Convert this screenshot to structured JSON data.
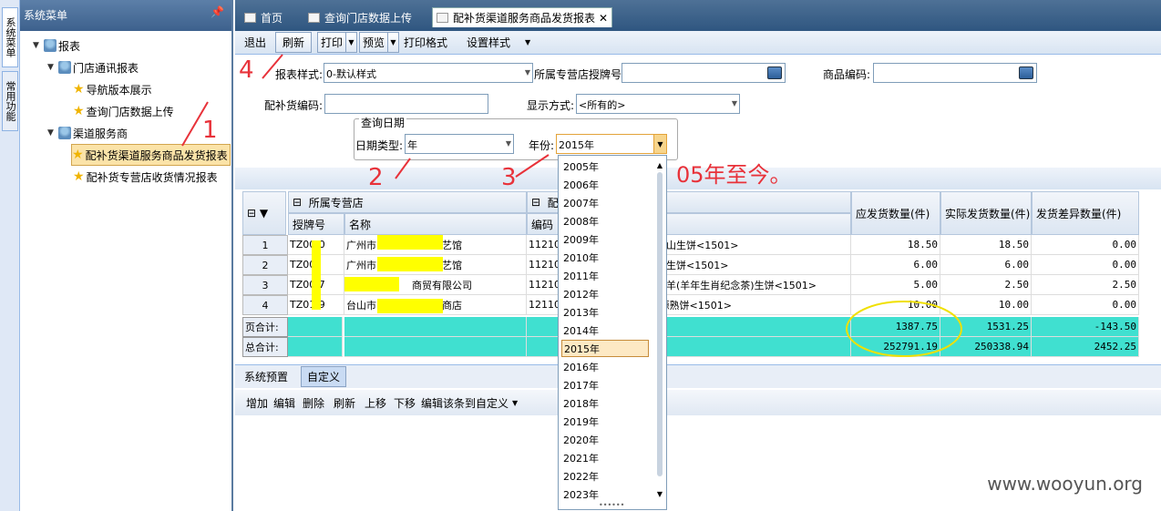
{
  "side_tabs": [
    "系统菜单",
    "常用功能"
  ],
  "sidebar": {
    "title": "系统菜单",
    "tree": [
      {
        "label": "报表",
        "level": 0
      },
      {
        "label": "门店通讯报表",
        "level": 1
      },
      {
        "label": "导航版本展示",
        "level": 2
      },
      {
        "label": "查询门店数据上传",
        "level": 2
      },
      {
        "label": "渠道服务商",
        "level": 1
      },
      {
        "label": "配补货渠道服务商品发货报表",
        "level": 2
      },
      {
        "label": "配补货专营店收货情况报表",
        "level": 2
      }
    ]
  },
  "tabs": [
    "首页",
    "查询门店数据上传",
    "配补货渠道服务商品发货报表"
  ],
  "toolbar": {
    "exit": "退出",
    "refresh": "刷新",
    "print": "打印",
    "preview": "预览",
    "print_format": "打印格式",
    "set_style": "设置样式"
  },
  "form": {
    "style_label": "报表样式:",
    "style_value": "0-默认样式",
    "store_label": "所属专营店授牌号",
    "code_label": "商品编码:",
    "dist_label": "配补货编码:",
    "mode_label": "显示方式:",
    "mode_value": "<所有的>",
    "group_title": "查询日期",
    "date_type_label": "日期类型:",
    "date_type_value": "年",
    "year_label": "年份:",
    "year_value": "2015年"
  },
  "year_options": [
    "2005年",
    "2006年",
    "2007年",
    "2008年",
    "2009年",
    "2010年",
    "2011年",
    "2012年",
    "2013年",
    "2014年",
    "2015年",
    "2016年",
    "2017年",
    "2018年",
    "2019年",
    "2020年",
    "2021年",
    "2022年",
    "2023年"
  ],
  "grid": {
    "group_store": "所属专营店",
    "group_goods": "配",
    "col_license": "授牌号",
    "col_name": "名称",
    "col_code": "编码",
    "col_due": "应发货数量(件)",
    "col_actual": "实际发货数量(件)",
    "col_diff": "发货差异数量(件)",
    "rows": [
      {
        "n": "1",
        "license": "TZ00 0",
        "name_a": "广州市",
        "name_b": "艺馆",
        "code": "11210",
        "goods": "象山生饼<1501>",
        "due": "18.50",
        "actual": "18.50",
        "diff": "0.00"
      },
      {
        "n": "2",
        "license": "TZ00",
        "name_a": "广州市",
        "name_b": "艺馆",
        "code": "11210",
        "goods": "益生饼<1501>",
        "due": "6.00",
        "actual": "6.00",
        "diff": "0.00"
      },
      {
        "n": "3",
        "license": "TZ00 7",
        "name_a": "",
        "name_b": "商贸有限公司",
        "code": "11210",
        "goods": "祥羊(羊年生肖纪念茶)生饼<1501>",
        "due": "5.00",
        "actual": "2.50",
        "diff": "2.50"
      },
      {
        "n": "4",
        "license": "TZ01 9",
        "name_a": "台山市",
        "name_b": "商店",
        "code": "12110",
        "goods": "·源熟饼<1501>",
        "due": "10.00",
        "actual": "10.00",
        "diff": "0.00"
      }
    ],
    "page_total_label": "页合计:",
    "page_due": "1387.75",
    "page_actual": "1531.25",
    "page_diff": "-143.50",
    "total_label": "总合计:",
    "total_due": "252791.19",
    "total_actual": "250338.94",
    "total_diff": "2452.25"
  },
  "bottom_tabs": [
    "系统预置",
    "自定义"
  ],
  "bottom_toolbar": [
    "增加",
    "编辑",
    "删除",
    "刷新",
    "上移",
    "下移",
    "编辑该条到自定义"
  ],
  "annotations": {
    "n1": "1",
    "n2": "2",
    "n3": "3",
    "n4": "4",
    "note": "05年至今。"
  },
  "watermark": "www.wooyun.org",
  "colors": {
    "annotation": "#e8323a",
    "total_row": "#40e0d0",
    "redaction": "#ffff00"
  }
}
